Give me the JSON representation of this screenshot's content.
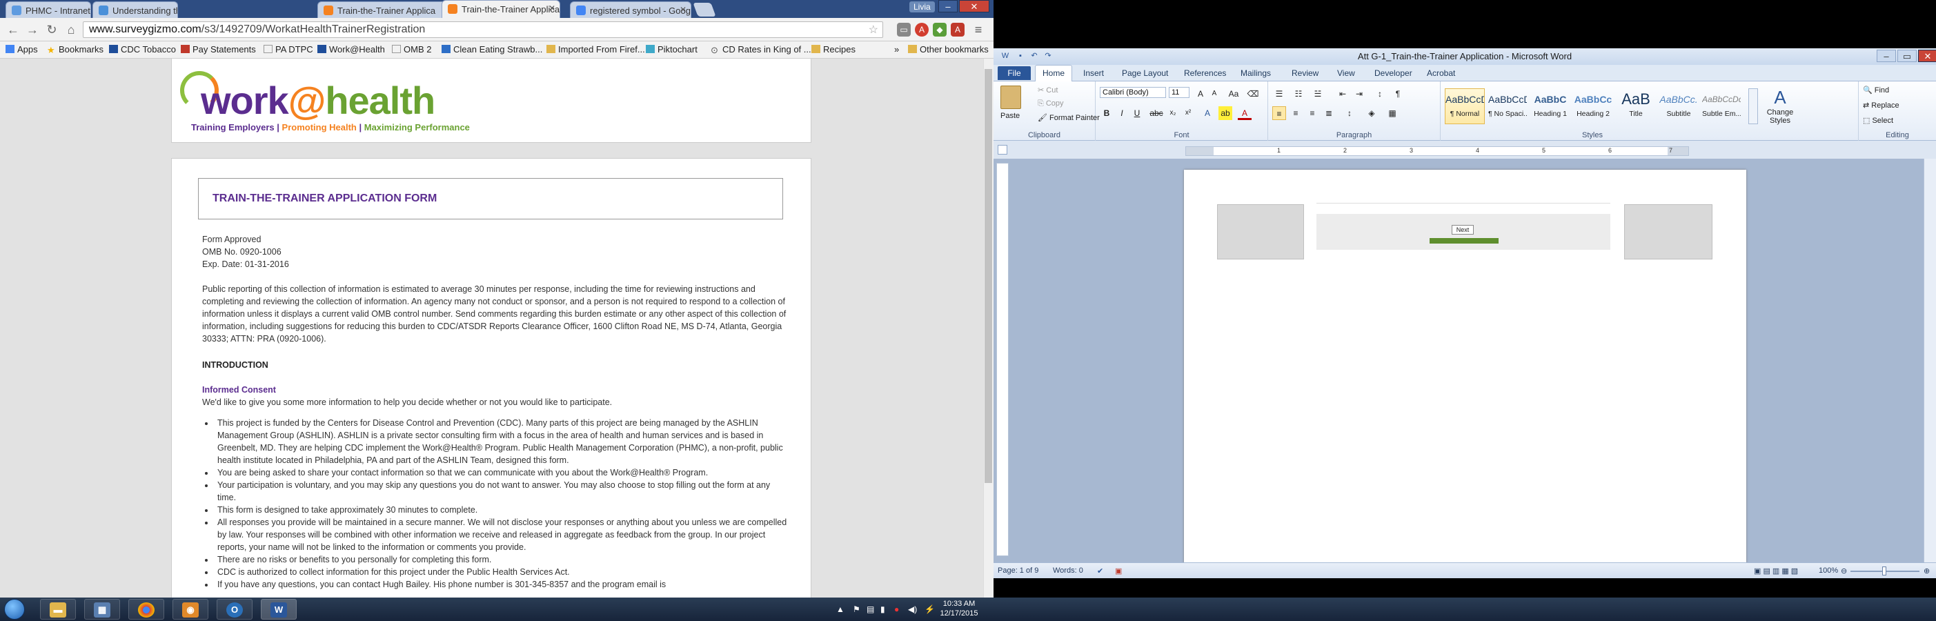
{
  "chrome": {
    "tabs": [
      {
        "label": "PHMC - Intranet - PHMC",
        "fav_color": "#5e9be0",
        "active": false
      },
      {
        "label": "Understanding the Purpo",
        "fav_color": "#4a90d9",
        "active": false
      },
      {
        "label": "Train-the-Trainer Applica",
        "fav_color": "#f58220",
        "active": false
      },
      {
        "label": "Train-the-Trainer Applicat",
        "fav_color": "#f58220",
        "active": true
      },
      {
        "label": "registered symbol - Goog",
        "fav_color": "#4285f4",
        "active": false
      }
    ],
    "user_badge": "Livia",
    "url_host": "www.surveygizmo.com",
    "url_path": "/s3/1492709/WorkatHealthTrainerRegistration",
    "bookmarks": [
      {
        "label": "Apps",
        "icon": "apps-icon",
        "color": "#4285f4"
      },
      {
        "label": "Bookmarks",
        "icon": "star-icon",
        "color": "#f4b400"
      },
      {
        "label": "CDC Tobacco",
        "icon": "cdc-icon",
        "color": "#1f4e9a"
      },
      {
        "label": "Pay Statements",
        "icon": "pay-icon",
        "color": "#c0392b"
      },
      {
        "label": "PA DTPC",
        "icon": "page-icon",
        "color": "#999999"
      },
      {
        "label": "Work@Health",
        "icon": "work-icon",
        "color": "#1f4e9a"
      },
      {
        "label": "OMB 2",
        "icon": "page-icon",
        "color": "#999999"
      },
      {
        "label": "Clean Eating Strawb...",
        "icon": "page-icon",
        "color": "#2e6fc7"
      },
      {
        "label": "Imported From Firef...",
        "icon": "folder-icon",
        "color": "#e1b64d"
      },
      {
        "label": "Piktochart",
        "icon": "pikto-icon",
        "color": "#3fa9c9"
      },
      {
        "label": "CD Rates in King of ...",
        "icon": "search-icon",
        "color": "#555555"
      },
      {
        "label": "Recipes",
        "icon": "folder-icon",
        "color": "#e1b64d"
      }
    ],
    "other_bookmarks": "Other bookmarks",
    "bookmarks_more": "»"
  },
  "form": {
    "logo_work": "work",
    "logo_at": "@",
    "logo_health": "health",
    "tagline_1": "Training Employers",
    "tagline_sep": " | ",
    "tagline_2": "Promoting Health",
    "tagline_3": "Maximizing Performance",
    "title": "TRAIN-THE-TRAINER APPLICATION FORM",
    "form_approved": "Form Approved",
    "omb": "OMB No. 0920-1006",
    "exp": "Exp. Date: 01-31-2016",
    "burden": "Public reporting of this collection of information is estimated to average 30 minutes per response, including the time for reviewing instructions and completing and reviewing the collection of information. An agency many not conduct or sponsor, and a person is not required to respond to a collection of information unless it displays a current valid OMB control number. Send comments regarding this burden estimate or any other aspect of this collection of information, including suggestions for reducing this burden to CDC/ATSDR Reports Clearance Officer, 1600 Clifton Road NE, MS D-74, Atlanta, Georgia 30333; ATTN: PRA (0920-1006).",
    "intro_heading": "INTRODUCTION",
    "consent_heading": "Informed Consent",
    "consent_intro": "We'd like to give you some more information to help you decide whether or not you would like to participate.",
    "bullets": [
      "This project is funded by the Centers for Disease Control and Prevention (CDC). Many parts of this project are being managed by the ASHLIN Management Group (ASHLIN). ASHLIN is a private sector consulting firm with a focus in the area of health and human services and is based in Greenbelt, MD. They are helping CDC implement the Work@Health® Program.  Public Health Management Corporation (PHMC), a non-profit, public health institute located in Philadelphia, PA and part of the ASHLIN Team, designed this form.",
      "You are being asked to share your contact information so that we can communicate with you about the Work@Health® Program.",
      "Your participation is voluntary, and you may skip any questions you do not want to answer.  You may also choose to stop filling out the form at any time.",
      "This form is designed to take approximately 30 minutes to complete.",
      "All responses you provide will be maintained in a secure manner.  We will not disclose your responses or anything about you unless we are compelled by law.  Your responses will be combined with other information we receive and released in aggregate as feedback from the group. In our project reports, your name will not be linked to the information or comments you provide.",
      "There are no risks or benefits to you personally for completing this form.",
      "CDC is authorized to collect information for this project under the Public Health Services Act.",
      "If you have any questions, you can contact Hugh Bailey.  His phone number is 301-345-8357 and the program email is"
    ]
  },
  "word": {
    "title": "Att G-1_Train-the-Trainer Application - Microsoft Word",
    "file_tab": "File",
    "tabs": [
      "Home",
      "Insert",
      "Page Layout",
      "References",
      "Mailings",
      "Review",
      "View",
      "Developer",
      "Acrobat"
    ],
    "clipboard": {
      "paste": "Paste",
      "cut": "Cut",
      "copy": "Copy",
      "format_painter": "Format Painter",
      "label": "Clipboard"
    },
    "font": {
      "name": "Calibri (Body)",
      "size": "11",
      "label": "Font"
    },
    "paragraph_label": "Paragraph",
    "styles": [
      {
        "preview": "AaBbCcDc",
        "name": "¶ Normal",
        "selected": true
      },
      {
        "preview": "AaBbCcDc",
        "name": "¶ No Spaci...",
        "selected": false
      },
      {
        "preview": "AaBbC",
        "name": "Heading 1",
        "selected": false
      },
      {
        "preview": "AaBbCc",
        "name": "Heading 2",
        "selected": false
      },
      {
        "preview": "AaB",
        "name": "Title",
        "selected": false
      },
      {
        "preview": "AaBbCc.",
        "name": "Subtitle",
        "selected": false
      },
      {
        "preview": "AaBbCcDc",
        "name": "Subtle Em...",
        "selected": false
      }
    ],
    "styles_label": "Styles",
    "change_styles": "Change Styles",
    "editing": {
      "find": "Find",
      "replace": "Replace",
      "select": "Select",
      "label": "Editing"
    },
    "ruler_numbers": [
      "1",
      "2",
      "3",
      "4",
      "5",
      "6",
      "7"
    ],
    "next_button": "Next",
    "status_page": "Page: 1 of 9",
    "status_words": "Words: 0",
    "zoom": "100%"
  },
  "taskbar": {
    "clock_time": "10:33 AM",
    "clock_date": "12/17/2015"
  }
}
